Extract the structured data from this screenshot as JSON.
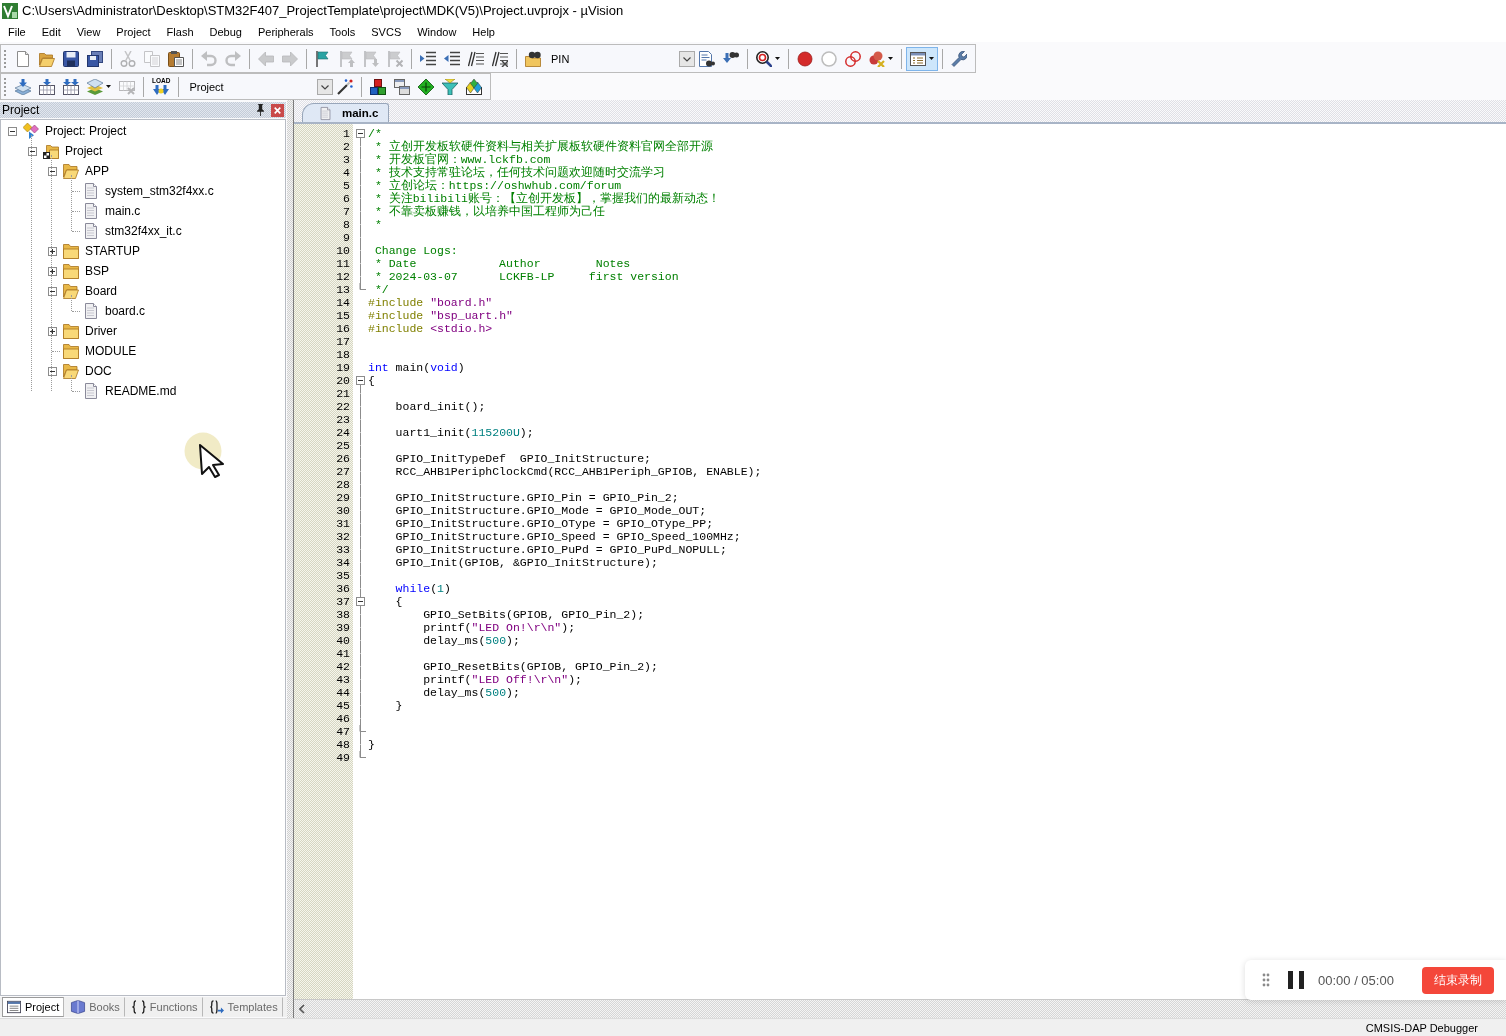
{
  "window": {
    "title": "C:\\Users\\Administrator\\Desktop\\STM32F407_ProjectTemplate\\project\\MDK(V5)\\Project.uvprojx - µVision"
  },
  "menu": [
    "File",
    "Edit",
    "View",
    "Project",
    "Flash",
    "Debug",
    "Peripherals",
    "Tools",
    "SVCS",
    "Window",
    "Help"
  ],
  "toolbar_1": {
    "buttons": [
      {
        "disabled": false,
        "pressed": false
      },
      {
        "disabled": false,
        "pressed": false
      },
      {
        "disabled": false,
        "pressed": false
      },
      {
        "disabled": false,
        "pressed": false
      },
      {
        "disabled": true,
        "pressed": false
      },
      {
        "disabled": true,
        "pressed": false
      },
      {
        "disabled": false,
        "pressed": false
      },
      {
        "disabled": true,
        "pressed": false
      },
      {
        "disabled": true,
        "pressed": false
      },
      {
        "disabled": true,
        "pressed": false
      },
      {
        "disabled": true,
        "pressed": false
      },
      {
        "disabled": false,
        "pressed": false
      },
      {
        "disabled": true,
        "pressed": false
      },
      {
        "disabled": true,
        "pressed": false
      },
      {
        "disabled": true,
        "pressed": false
      },
      {
        "disabled": false,
        "pressed": false
      },
      {
        "disabled": false,
        "pressed": false
      },
      {
        "disabled": false,
        "pressed": false
      },
      {
        "disabled": false,
        "pressed": false
      },
      {
        "disabled": false,
        "pressed": false
      },
      {
        "disabled": false,
        "pressed": false
      },
      {
        "disabled": false,
        "pressed": false
      },
      {
        "disabled": false,
        "pressed": false
      },
      {
        "disabled": false,
        "pressed": false
      },
      {
        "disabled": false,
        "pressed": false
      },
      {
        "disabled": false,
        "pressed": false
      },
      {
        "disabled": false,
        "pressed": false
      },
      {
        "disabled": false,
        "pressed": true
      },
      {
        "disabled": false,
        "pressed": false
      }
    ],
    "find_combo": {
      "value": "PIN"
    }
  },
  "toolbar_2": {
    "buttons": [
      {
        "disabled": false
      },
      {
        "disabled": false
      },
      {
        "disabled": false
      },
      {
        "disabled": false
      },
      {
        "disabled": true
      },
      {
        "disabled": false
      },
      {
        "disabled": false
      },
      {
        "disabled": false
      },
      {
        "disabled": false
      },
      {
        "disabled": false
      },
      {
        "disabled": false
      },
      {
        "disabled": false
      }
    ],
    "load_label": "LOAD",
    "target_combo": {
      "value": "Project"
    }
  },
  "project_panel": {
    "title": "Project",
    "tree": [
      {
        "label": "Project: Project",
        "kind": "project",
        "expanded": true,
        "children": [
          {
            "label": "Project",
            "kind": "target",
            "expanded": true,
            "children": [
              {
                "label": "APP",
                "kind": "group",
                "expanded": true,
                "children": [
                  {
                    "label": "system_stm32f4xx.c",
                    "kind": "file"
                  },
                  {
                    "label": "main.c",
                    "kind": "file"
                  },
                  {
                    "label": "stm32f4xx_it.c",
                    "kind": "file"
                  }
                ]
              },
              {
                "label": "STARTUP",
                "kind": "group",
                "expanded": false
              },
              {
                "label": "BSP",
                "kind": "group",
                "expanded": false
              },
              {
                "label": "Board",
                "kind": "group",
                "expanded": true,
                "children": [
                  {
                    "label": "board.c",
                    "kind": "file"
                  }
                ]
              },
              {
                "label": "Driver",
                "kind": "group",
                "expanded": false
              },
              {
                "label": "MODULE",
                "kind": "group"
              },
              {
                "label": "DOC",
                "kind": "group",
                "expanded": true,
                "children": [
                  {
                    "label": "README.md",
                    "kind": "file"
                  }
                ]
              }
            ]
          }
        ]
      }
    ],
    "tabs": [
      {
        "label": "Project",
        "selected": true
      },
      {
        "label": "Books",
        "selected": false
      },
      {
        "label": "Functions",
        "selected": false
      },
      {
        "label": "Templates",
        "selected": false
      }
    ]
  },
  "editor": {
    "tabs": [
      {
        "label": "main.c",
        "selected": true
      }
    ],
    "lines": [
      {
        "number": "1",
        "fold_start": true,
        "segments": [
          {
            "kind": "comment",
            "text": "/*"
          }
        ]
      },
      {
        "number": "2",
        "segments": [
          {
            "kind": "comment",
            "text": " * 立创开发板软硬件资料与相关扩展板软硬件资料官网全部开源"
          }
        ]
      },
      {
        "number": "3",
        "segments": [
          {
            "kind": "comment",
            "text": " * 开发板官网：www.lckfb.com"
          }
        ]
      },
      {
        "number": "4",
        "segments": [
          {
            "kind": "comment",
            "text": " * 技术支持常驻论坛，任何技术问题欢迎随时交流学习"
          }
        ]
      },
      {
        "number": "5",
        "segments": [
          {
            "kind": "comment",
            "text": " * 立创论坛：https://oshwhub.com/forum"
          }
        ]
      },
      {
        "number": "6",
        "segments": [
          {
            "kind": "comment",
            "text": " * 关注bilibili账号：【立创开发板】，掌握我们的最新动态！"
          }
        ]
      },
      {
        "number": "7",
        "segments": [
          {
            "kind": "comment",
            "text": " * 不靠卖板赚钱，以培养中国工程师为己任"
          }
        ]
      },
      {
        "number": "8",
        "segments": [
          {
            "kind": "comment",
            "text": " *"
          }
        ]
      },
      {
        "number": "9"
      },
      {
        "number": "10",
        "segments": [
          {
            "kind": "comment",
            "text": " Change Logs:"
          }
        ]
      },
      {
        "number": "11",
        "segments": [
          {
            "kind": "comment",
            "text": " * Date            Author        Notes"
          }
        ]
      },
      {
        "number": "12",
        "segments": [
          {
            "kind": "comment",
            "text": " * 2024-03-07      LCKFB-LP     first version"
          }
        ]
      },
      {
        "number": "13",
        "fold_end": true,
        "segments": [
          {
            "kind": "comment",
            "text": " */"
          }
        ]
      },
      {
        "number": "14",
        "segments": [
          {
            "kind": "preprocessor",
            "text": "#include "
          },
          {
            "kind": "string",
            "text": "\"board.h\""
          }
        ]
      },
      {
        "number": "15",
        "segments": [
          {
            "kind": "preprocessor",
            "text": "#include "
          },
          {
            "kind": "string",
            "text": "\"bsp_uart.h\""
          }
        ]
      },
      {
        "number": "16",
        "segments": [
          {
            "kind": "preprocessor",
            "text": "#include "
          },
          {
            "kind": "string",
            "text": "<stdio.h>"
          }
        ]
      },
      {
        "number": "17"
      },
      {
        "number": "18"
      },
      {
        "number": "19",
        "segments": [
          {
            "kind": "keyword",
            "text": "int"
          },
          {
            "kind": "plain",
            "text": " main("
          },
          {
            "kind": "keyword",
            "text": "void"
          },
          {
            "kind": "plain",
            "text": ")"
          }
        ]
      },
      {
        "number": "20",
        "fold_start": true,
        "segments": [
          {
            "kind": "plain",
            "text": "{"
          }
        ]
      },
      {
        "number": "21"
      },
      {
        "number": "22",
        "segments": [
          {
            "kind": "plain",
            "text": "    board_init();"
          }
        ]
      },
      {
        "number": "23"
      },
      {
        "number": "24",
        "segments": [
          {
            "kind": "plain",
            "text": "    uart1_init("
          },
          {
            "kind": "number",
            "text": "115200U"
          },
          {
            "kind": "plain",
            "text": ");"
          }
        ]
      },
      {
        "number": "25"
      },
      {
        "number": "26",
        "segments": [
          {
            "kind": "plain",
            "text": "    GPIO_InitTypeDef  GPIO_InitStructure;"
          }
        ]
      },
      {
        "number": "27",
        "segments": [
          {
            "kind": "plain",
            "text": "    RCC_AHB1PeriphClockCmd(RCC_AHB1Periph_GPIOB, ENABLE);"
          }
        ]
      },
      {
        "number": "28"
      },
      {
        "number": "29",
        "segments": [
          {
            "kind": "plain",
            "text": "    GPIO_InitStructure.GPIO_Pin = GPIO_Pin_2;"
          }
        ]
      },
      {
        "number": "30",
        "segments": [
          {
            "kind": "plain",
            "text": "    GPIO_InitStructure.GPIO_Mode = GPIO_Mode_OUT;"
          }
        ]
      },
      {
        "number": "31",
        "segments": [
          {
            "kind": "plain",
            "text": "    GPIO_InitStructure.GPIO_OType = GPIO_OType_PP;"
          }
        ]
      },
      {
        "number": "32",
        "segments": [
          {
            "kind": "plain",
            "text": "    GPIO_InitStructure.GPIO_Speed = GPIO_Speed_100MHz;"
          }
        ]
      },
      {
        "number": "33",
        "segments": [
          {
            "kind": "plain",
            "text": "    GPIO_InitStructure.GPIO_PuPd = GPIO_PuPd_NOPULL;"
          }
        ]
      },
      {
        "number": "34",
        "segments": [
          {
            "kind": "plain",
            "text": "    GPIO_Init(GPIOB, &GPIO_InitStructure);"
          }
        ]
      },
      {
        "number": "35"
      },
      {
        "number": "36",
        "segments": [
          {
            "kind": "keyword",
            "text": "    while"
          },
          {
            "kind": "plain",
            "text": "("
          },
          {
            "kind": "number",
            "text": "1"
          },
          {
            "kind": "plain",
            "text": ")"
          }
        ]
      },
      {
        "number": "37",
        "fold_start": true,
        "segments": [
          {
            "kind": "plain",
            "text": "    {"
          }
        ]
      },
      {
        "number": "38",
        "segments": [
          {
            "kind": "plain",
            "text": "        GPIO_SetBits(GPIOB, GPIO_Pin_2);"
          }
        ]
      },
      {
        "number": "39",
        "segments": [
          {
            "kind": "plain",
            "text": "        printf("
          },
          {
            "kind": "string",
            "text": "\"LED On!\\r\\n\""
          },
          {
            "kind": "plain",
            "text": ");"
          }
        ]
      },
      {
        "number": "40",
        "segments": [
          {
            "kind": "plain",
            "text": "        delay_ms("
          },
          {
            "kind": "number",
            "text": "500"
          },
          {
            "kind": "plain",
            "text": ");"
          }
        ]
      },
      {
        "number": "41"
      },
      {
        "number": "42",
        "segments": [
          {
            "kind": "plain",
            "text": "        GPIO_ResetBits(GPIOB, GPIO_Pin_2);"
          }
        ]
      },
      {
        "number": "43",
        "segments": [
          {
            "kind": "plain",
            "text": "        printf("
          },
          {
            "kind": "string",
            "text": "\"LED Off!\\r\\n\""
          },
          {
            "kind": "plain",
            "text": ");"
          }
        ]
      },
      {
        "number": "44",
        "segments": [
          {
            "kind": "plain",
            "text": "        delay_ms("
          },
          {
            "kind": "number",
            "text": "500"
          },
          {
            "kind": "plain",
            "text": ");"
          }
        ]
      },
      {
        "number": "45",
        "segments": [
          {
            "kind": "plain",
            "text": "    }"
          }
        ]
      },
      {
        "number": "46"
      },
      {
        "number": "47",
        "fold_end": true
      },
      {
        "number": "48",
        "segments": [
          {
            "kind": "plain",
            "text": "}"
          }
        ]
      },
      {
        "number": "49",
        "fold_end": true
      }
    ]
  },
  "recorder": {
    "time": "00:00 / 05:00",
    "stop_button": "结束录制"
  },
  "status_bar": {
    "target": "CMSIS-DAP Debugger"
  }
}
